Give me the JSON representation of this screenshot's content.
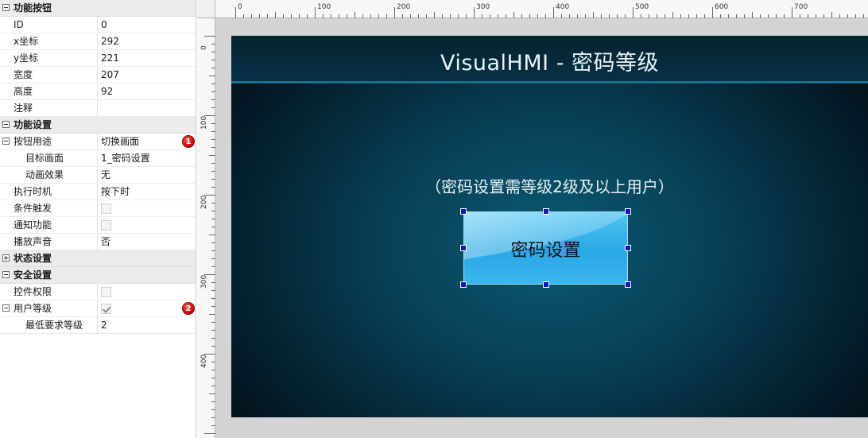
{
  "properties": [
    {
      "type": "cat",
      "label": "功能按钮",
      "toggle": "minus"
    },
    {
      "type": "row",
      "label": "ID",
      "value": "0"
    },
    {
      "type": "row",
      "label": "x坐标",
      "value": "292"
    },
    {
      "type": "row",
      "label": "y坐标",
      "value": "221"
    },
    {
      "type": "row",
      "label": "宽度",
      "value": "207"
    },
    {
      "type": "row",
      "label": "高度",
      "value": "92"
    },
    {
      "type": "row",
      "label": "注释",
      "value": ""
    },
    {
      "type": "cat",
      "label": "功能设置",
      "toggle": "minus"
    },
    {
      "type": "row",
      "label": "按钮用途",
      "value": "切换画面",
      "toggle": "minus",
      "badge": "1"
    },
    {
      "type": "row",
      "label": "目标画面",
      "value": "1_密码设置",
      "indent": 1
    },
    {
      "type": "row",
      "label": "动画效果",
      "value": "无",
      "indent": 1
    },
    {
      "type": "row",
      "label": "执行时机",
      "value": "按下时"
    },
    {
      "type": "row",
      "label": "条件触发",
      "checkbox": false
    },
    {
      "type": "row",
      "label": "通知功能",
      "checkbox": false
    },
    {
      "type": "row",
      "label": "播放声音",
      "value": "否"
    },
    {
      "type": "cat",
      "label": "状态设置",
      "toggle": "plus"
    },
    {
      "type": "cat",
      "label": "安全设置",
      "toggle": "minus"
    },
    {
      "type": "row",
      "label": "控件权限",
      "checkbox": false
    },
    {
      "type": "row",
      "label": "用户等级",
      "checkbox": true,
      "toggle": "minus",
      "badge": "2"
    },
    {
      "type": "row",
      "label": "最低要求等级",
      "value": "2",
      "indent": 1
    }
  ],
  "ruler": {
    "top_labels": [
      "0",
      "100",
      "200",
      "300",
      "400",
      "500",
      "600",
      "700"
    ],
    "left_labels": [
      "0",
      "100",
      "200",
      "300",
      "400"
    ]
  },
  "hmi": {
    "title": "VisualHMI - 密码等级",
    "hint": "（密码设置需等级2级及以上用户）",
    "button_label": "密码设置"
  },
  "colors": {
    "screen_bg": "#073f55",
    "button_fill": "#2aa8e6",
    "selection_handle": "#1414c8",
    "badge": "#c40000"
  }
}
